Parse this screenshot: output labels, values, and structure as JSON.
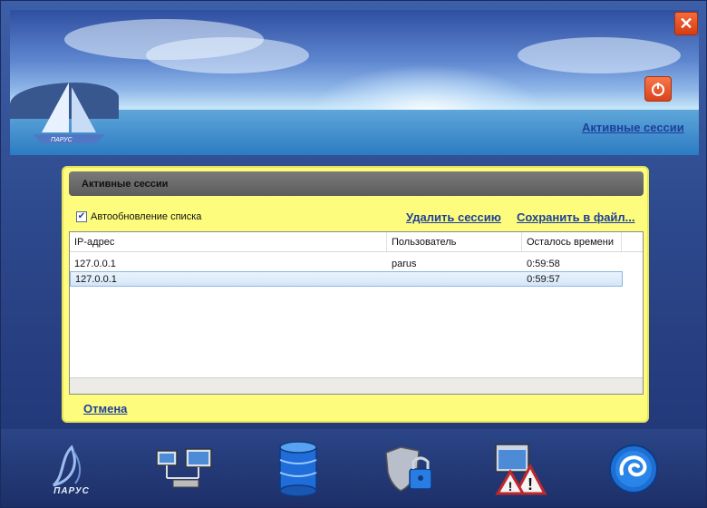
{
  "header": {
    "link": "Активные сессии",
    "close_icon": "close-icon",
    "power_icon": "power-icon"
  },
  "panel": {
    "title": "Активные сессии",
    "autoupdate_label": "Автообновление списка",
    "autoupdate_checked": true,
    "delete_session": "Удалить сессию",
    "save_to_file": "Сохранить в файл...",
    "cancel": "Отмена"
  },
  "table": {
    "columns": [
      "IP-адрес",
      "Пользователь",
      "Осталось времени"
    ],
    "rows": [
      {
        "ip": "127.0.0.1",
        "user": "parus",
        "time": "0:59:58"
      },
      {
        "ip": "127.0.0.1",
        "user": "",
        "time": "0:59:57"
      }
    ],
    "selected_row": 1
  },
  "toolbar": {
    "items": [
      {
        "icon": "parus-logo-icon",
        "label": "ПАРУС"
      },
      {
        "icon": "network-computers-icon"
      },
      {
        "icon": "database-icon"
      },
      {
        "icon": "shield-lock-icon"
      },
      {
        "icon": "warning-windows-icon"
      },
      {
        "icon": "globe-swirl-icon"
      }
    ]
  },
  "colors": {
    "panel_bg": "#fdfc7c",
    "link": "#1e3f9a",
    "close": "#d63c12"
  }
}
